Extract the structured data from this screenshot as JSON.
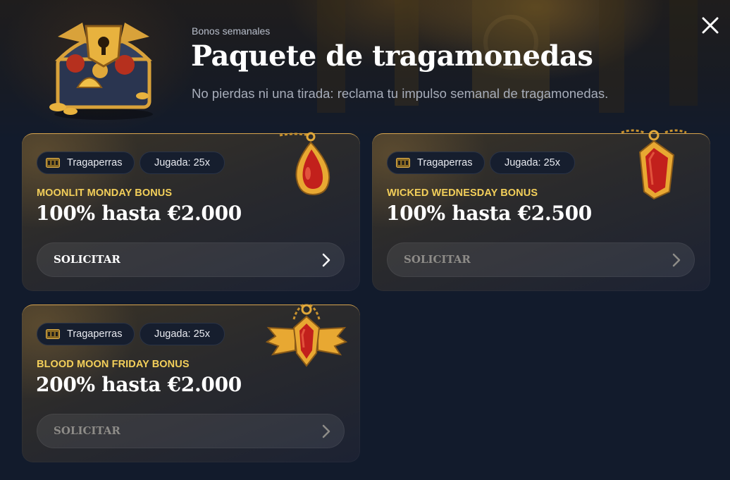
{
  "header": {
    "eyebrow": "Bonos semanales",
    "title": "Paquete de tragamonedas",
    "subtitle": "No pierdas ni una tirada: reclama tu impulso semanal de tragamonedas."
  },
  "close_icon": "close-icon",
  "hero_image": "treasure-chest",
  "colors": {
    "background": "#121b2c",
    "accent_gold": "#f3cf5a",
    "card_border": "#d3a04a",
    "pill_bg": "#161e2e"
  },
  "bonuses": [
    {
      "tag_type": "Tragaperras",
      "tag_wager": "Jugada: 25x",
      "name": "MOONLIT MONDAY BONUS",
      "amount": "100% hasta €2.000",
      "claim_label": "SOLICITAR",
      "claim_active": true,
      "icon": "teardrop-amulet-icon"
    },
    {
      "tag_type": "Tragaperras",
      "tag_wager": "Jugada: 25x",
      "name": "WICKED WEDNESDAY BONUS",
      "amount": "100% hasta €2.500",
      "claim_label": "SOLICITAR",
      "claim_active": false,
      "icon": "coffin-amulet-icon"
    },
    {
      "tag_type": "Tragaperras",
      "tag_wager": "Jugada: 25x",
      "name": "BLOOD MOON FRIDAY BONUS",
      "amount": "200% hasta €2.000",
      "claim_label": "SOLICITAR",
      "claim_active": false,
      "icon": "bat-wing-amulet-icon"
    }
  ]
}
